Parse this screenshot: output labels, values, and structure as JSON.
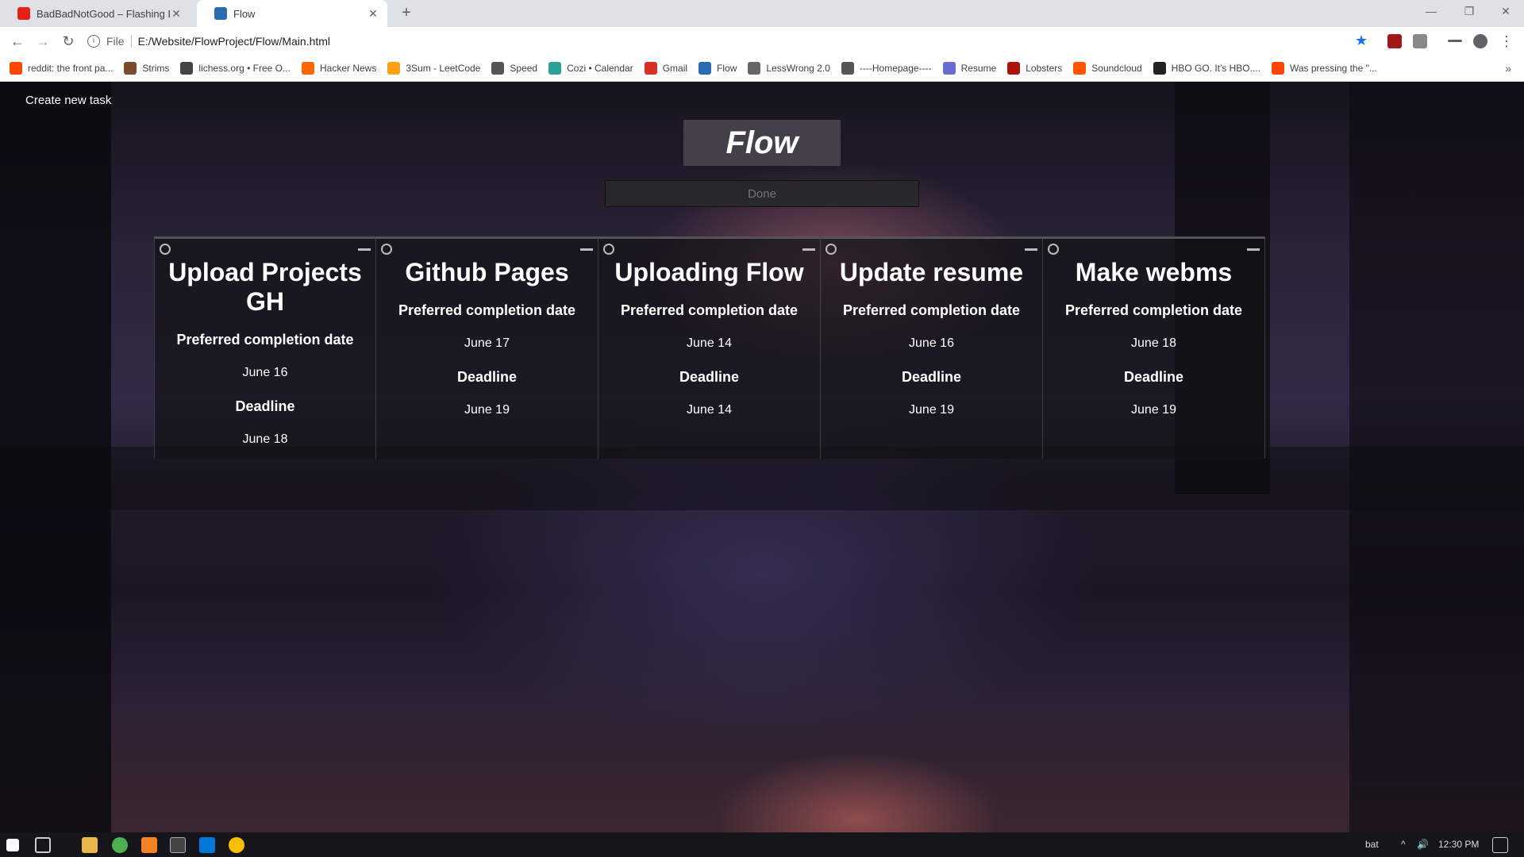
{
  "browser": {
    "tabs": [
      {
        "title": "BadBadNotGood – Flashing Lights",
        "icon": "youtube-icon",
        "color": "#e62117"
      },
      {
        "title": "Flow",
        "icon": "flow-icon",
        "color": "#2b6cb0"
      }
    ],
    "new_tab": "+",
    "url_scheme": "File",
    "url": "E:/Website/FlowProject/Flow/Main.html",
    "bookmarks": [
      {
        "label": "reddit: the front pa...",
        "color": "#ff4500"
      },
      {
        "label": "Strims",
        "color": "#7a4b2a"
      },
      {
        "label": "lichess.org • Free O...",
        "color": "#444444"
      },
      {
        "label": "Hacker News",
        "color": "#ff6600"
      },
      {
        "label": "3Sum - LeetCode",
        "color": "#ffa116"
      },
      {
        "label": "Speed",
        "color": "#555555"
      },
      {
        "label": "Cozi • Calendar",
        "color": "#2aa198"
      },
      {
        "label": "Gmail",
        "color": "#d93025"
      },
      {
        "label": "Flow",
        "color": "#2b6cb0"
      },
      {
        "label": "LessWrong 2.0",
        "color": "#666666"
      },
      {
        "label": "----Homepage----",
        "color": "#555555"
      },
      {
        "label": "Resume",
        "color": "#6b6bd6"
      },
      {
        "label": "Lobsters",
        "color": "#ac130d"
      },
      {
        "label": "Soundcloud",
        "color": "#ff5500"
      },
      {
        "label": "HBO GO. It's HBO....",
        "color": "#222222"
      },
      {
        "label": "Was pressing the \"...",
        "color": "#ff4500"
      }
    ],
    "bookmarks_more": "»"
  },
  "app": {
    "create_task": "Create new task",
    "title": "Flow",
    "done_button": "Done",
    "tasks": [
      {
        "title": "Upload Projects GH",
        "preferred_label": "Preferred completion date",
        "preferred_date": "June 16",
        "deadline_label": "Deadline",
        "deadline_date": "June 18"
      },
      {
        "title": "Github Pages",
        "preferred_label": "Preferred completion date",
        "preferred_date": "June 17",
        "deadline_label": "Deadline",
        "deadline_date": "June 19"
      },
      {
        "title": "Uploading Flow",
        "preferred_label": "Preferred completion date",
        "preferred_date": "June 14",
        "deadline_label": "Deadline",
        "deadline_date": "June 14"
      },
      {
        "title": "Update resume",
        "preferred_label": "Preferred completion date",
        "preferred_date": "June 16",
        "deadline_label": "Deadline",
        "deadline_date": "June 19"
      },
      {
        "title": "Make webms",
        "preferred_label": "Preferred completion date",
        "preferred_date": "June 18",
        "deadline_label": "Deadline",
        "deadline_date": "June 19"
      }
    ]
  },
  "taskbar": {
    "tray_text": "bat",
    "time": "12:30 PM"
  }
}
